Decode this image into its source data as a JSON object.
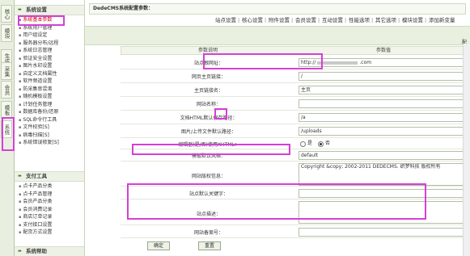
{
  "vtabs": [
    {
      "label": "核心"
    },
    {
      "label": "模块"
    },
    {
      "label": "生成"
    },
    {
      "label": "采集"
    },
    {
      "label": "会员"
    },
    {
      "label": "模板"
    },
    {
      "label": "系统"
    }
  ],
  "sidebar": {
    "sections": [
      {
        "title": "系统设置",
        "items": [
          {
            "label": "系统基本参数"
          },
          {
            "label": "系统用户管理"
          },
          {
            "label": "用户组设定"
          },
          {
            "label": "服务器分布/远程"
          },
          {
            "label": "系统日志管理"
          },
          {
            "label": "验证安全设置"
          },
          {
            "label": "图片水印设置"
          },
          {
            "label": "自定义文档属性"
          },
          {
            "label": "软件频道设置"
          },
          {
            "label": "防采集串混淆"
          },
          {
            "label": "随机模板设置"
          },
          {
            "label": "计划任务管理"
          },
          {
            "label": "数据库备份/还原"
          },
          {
            "label": "SQL命令行工具"
          },
          {
            "label": "文件校验[S]"
          },
          {
            "label": "病毒扫描[S]"
          },
          {
            "label": "系统错误修复[S]"
          }
        ]
      },
      {
        "title": "支付工具",
        "items": [
          {
            "label": "点卡产品分类"
          },
          {
            "label": "点卡产品管理"
          },
          {
            "label": "会员产品分类"
          },
          {
            "label": "会员消费记录"
          },
          {
            "label": "商店订单记录"
          },
          {
            "label": "支付接口设置"
          },
          {
            "label": "配货方式设置"
          }
        ]
      },
      {
        "title": "系统帮助"
      }
    ]
  },
  "main": {
    "page_title": "DedeCMS系统配置参数：",
    "tabs": [
      "站点设置",
      "核心设置",
      "附件设置",
      "会员设置",
      "互动设置",
      "性能选项",
      "其它选项",
      "模块设置",
      "添加新变量"
    ],
    "subbar_corner": "配",
    "table": {
      "col_label": "参数说明",
      "col_value": "参数值",
      "rows": [
        {
          "label": "站点根网址：",
          "value_prefix": "http://",
          "value_suffix": ".com"
        },
        {
          "label": "网页主页链接：",
          "value": "/"
        },
        {
          "label": "主页链接名：",
          "value": "主页"
        },
        {
          "label": "网站名称：",
          "value": ""
        },
        {
          "label": "文档HTML默认保存路径：",
          "value": "/a"
        },
        {
          "label": "图片/上传文件默认路径：",
          "value": "/uploads"
        },
        {
          "label": "编辑器(是/否)使用XHTML：",
          "options": [
            "是",
            "否"
          ],
          "selected": "否"
        },
        {
          "label": "模板默认风格：",
          "value": "default"
        },
        {
          "label": "网站版权信息：",
          "value": "Copyright &copy; 2002-2011 DEDECMS. 织梦科技 版权所有"
        },
        {
          "label": "站点默认关键字：",
          "value": ""
        },
        {
          "label": "站点描述：",
          "value": ""
        },
        {
          "label": "网站备案号：",
          "value": ""
        }
      ]
    },
    "buttons": {
      "ok": "确定",
      "reset": "重置"
    }
  },
  "colors": {
    "highlight": "#d63fd6",
    "selected_text": "#cc0000",
    "accent_bg": "#e9f0df"
  }
}
